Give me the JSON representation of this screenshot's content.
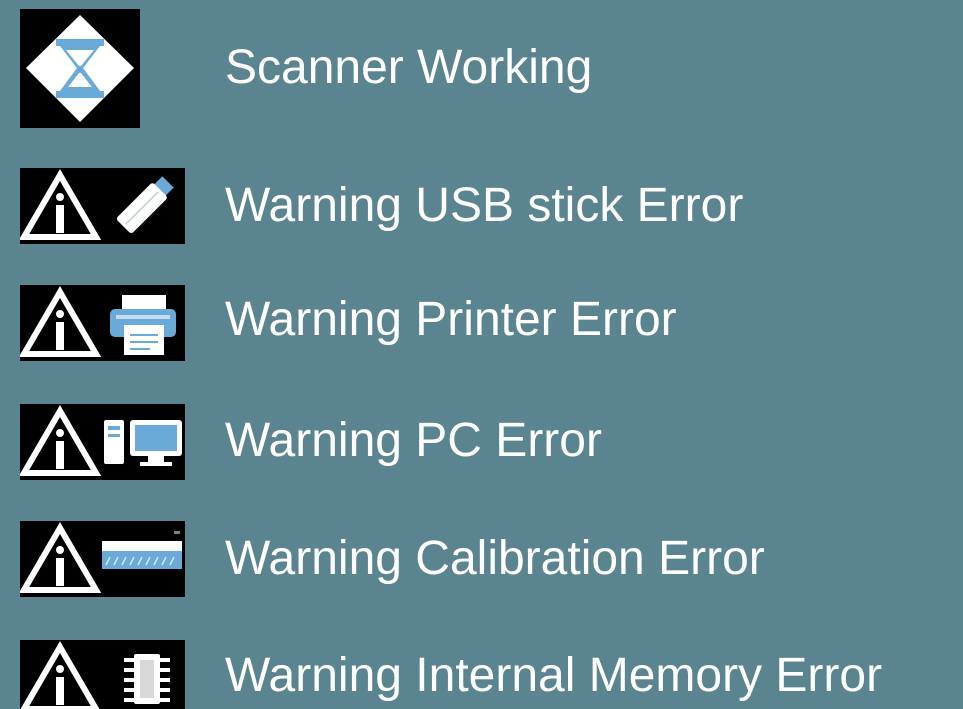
{
  "colors": {
    "background": "#5a8590",
    "icon_background": "#000000",
    "icon_white": "#ffffff",
    "icon_accent": "#6aaad8",
    "text": "#ffffff"
  },
  "rows": [
    {
      "label": "Scanner Working",
      "icon": "hourglass-icon"
    },
    {
      "label": "Warning USB stick Error",
      "icon": "usb-stick-icon"
    },
    {
      "label": "Warning Printer Error",
      "icon": "printer-icon"
    },
    {
      "label": "Warning PC Error",
      "icon": "pc-icon"
    },
    {
      "label": "Warning Calibration Error",
      "icon": "calibration-icon"
    },
    {
      "label": "Warning Internal Memory Error",
      "icon": "memory-chip-icon"
    }
  ]
}
